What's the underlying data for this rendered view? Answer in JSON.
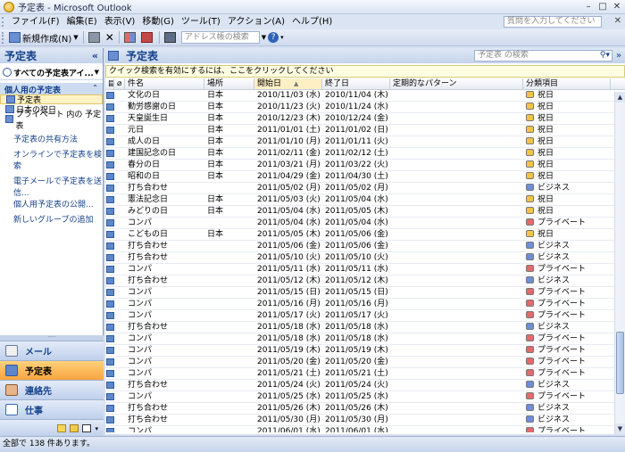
{
  "window": {
    "title": "予定表 - Microsoft Outlook"
  },
  "menu": {
    "items": [
      "ファイル(F)",
      "編集(E)",
      "表示(V)",
      "移動(G)",
      "ツール(T)",
      "アクション(A)",
      "ヘルプ(H)"
    ],
    "help_placeholder": "質問を入力してください"
  },
  "toolbar": {
    "new_label": "新規作成(N)",
    "address_search_placeholder": "アドレス帳の検索"
  },
  "nav": {
    "title": "予定表",
    "all_calendars": "すべての予定表アイ...",
    "group_title": "個人用の予定表",
    "calendars": [
      "予定表",
      "日本の祝日",
      "プライベート 内の 予定表"
    ],
    "links": [
      "予定表の共有方法",
      "オンラインで予定表を検索",
      "電子メールで予定表を送信...",
      "個人用予定表の公開...",
      "新しいグループの追加"
    ],
    "buttons": [
      "メール",
      "予定表",
      "連絡先",
      "仕事"
    ]
  },
  "main": {
    "title": "予定表",
    "search_placeholder": "予定表 の検索",
    "infobar": "クイック検索を有効にするには、ここをクリックしてください",
    "columns": [
      "件名",
      "場所",
      "開始日",
      "終了日",
      "定期的なパターン",
      "分類項目"
    ]
  },
  "colors": {
    "holiday": "#f3c24a",
    "business": "#6e8fd6",
    "private": "#e06b6b"
  },
  "rows": [
    {
      "subject": "文化の日",
      "location": "日本",
      "start": "2010/11/03 (水) 0...",
      "end": "2010/11/04 (木) 0...",
      "category": "祝日",
      "cat": "holiday"
    },
    {
      "subject": "勤労感謝の日",
      "location": "日本",
      "start": "2010/11/23 (火) 0...",
      "end": "2010/11/24 (水) 0...",
      "category": "祝日",
      "cat": "holiday"
    },
    {
      "subject": "天皇誕生日",
      "location": "日本",
      "start": "2010/12/23 (木) 0...",
      "end": "2010/12/24 (金) 0...",
      "category": "祝日",
      "cat": "holiday"
    },
    {
      "subject": "元日",
      "location": "日本",
      "start": "2011/01/01 (土) 0...",
      "end": "2011/01/02 (日) 0...",
      "category": "祝日",
      "cat": "holiday"
    },
    {
      "subject": "成人の日",
      "location": "日本",
      "start": "2011/01/10 (月) 0...",
      "end": "2011/01/11 (火) 0...",
      "category": "祝日",
      "cat": "holiday"
    },
    {
      "subject": "建国記念の日",
      "location": "日本",
      "start": "2011/02/11 (金) 0...",
      "end": "2011/02/12 (土) 0...",
      "category": "祝日",
      "cat": "holiday"
    },
    {
      "subject": "春分の日",
      "location": "日本",
      "start": "2011/03/21 (月) 0...",
      "end": "2011/03/22 (火) 0...",
      "category": "祝日",
      "cat": "holiday"
    },
    {
      "subject": "昭和の日",
      "location": "日本",
      "start": "2011/04/29 (金) 0...",
      "end": "2011/04/30 (土) 0...",
      "category": "祝日",
      "cat": "holiday"
    },
    {
      "subject": "打ち合わせ",
      "location": "",
      "start": "2011/05/02 (月) 9...",
      "end": "2011/05/02 (月) 9...",
      "category": "ビジネス",
      "cat": "business"
    },
    {
      "subject": "憲法記念日",
      "location": "日本",
      "start": "2011/05/03 (火) 0...",
      "end": "2011/05/04 (水) 0...",
      "category": "祝日",
      "cat": "holiday"
    },
    {
      "subject": "みどりの日",
      "location": "日本",
      "start": "2011/05/04 (水) 0...",
      "end": "2011/05/05 (木) 0...",
      "category": "祝日",
      "cat": "holiday"
    },
    {
      "subject": "コンパ",
      "location": "",
      "start": "2011/05/04 (水) 1...",
      "end": "2011/05/04 (水) 1...",
      "category": "プライベート",
      "cat": "private"
    },
    {
      "subject": "こどもの日",
      "location": "日本",
      "start": "2011/05/05 (木) 0...",
      "end": "2011/05/06 (金) 0...",
      "category": "祝日",
      "cat": "holiday"
    },
    {
      "subject": "打ち合わせ",
      "location": "",
      "start": "2011/05/06 (金) 9...",
      "end": "2011/05/06 (金) 9...",
      "category": "ビジネス",
      "cat": "business"
    },
    {
      "subject": "打ち合わせ",
      "location": "",
      "start": "2011/05/10 (火) 9...",
      "end": "2011/05/10 (火) 9...",
      "category": "ビジネス",
      "cat": "business"
    },
    {
      "subject": "コンパ",
      "location": "",
      "start": "2011/05/11 (水) 1...",
      "end": "2011/05/11 (水) 1...",
      "category": "プライベート",
      "cat": "private"
    },
    {
      "subject": "打ち合わせ",
      "location": "",
      "start": "2011/05/12 (木) 9...",
      "end": "2011/05/12 (木) 9...",
      "category": "ビジネス",
      "cat": "business"
    },
    {
      "subject": "コンパ",
      "location": "",
      "start": "2011/05/15 (日) 1...",
      "end": "2011/05/15 (日) 1...",
      "category": "プライベート",
      "cat": "private"
    },
    {
      "subject": "コンパ",
      "location": "",
      "start": "2011/05/16 (月) 1...",
      "end": "2011/05/16 (月) 1...",
      "category": "プライベート",
      "cat": "private"
    },
    {
      "subject": "コンパ",
      "location": "",
      "start": "2011/05/17 (火) 1...",
      "end": "2011/05/17 (火) 1...",
      "category": "プライベート",
      "cat": "private"
    },
    {
      "subject": "打ち合わせ",
      "location": "",
      "start": "2011/05/18 (水) 9...",
      "end": "2011/05/18 (水) 9...",
      "category": "ビジネス",
      "cat": "business"
    },
    {
      "subject": "コンパ",
      "location": "",
      "start": "2011/05/18 (水) 1...",
      "end": "2011/05/18 (水) 1...",
      "category": "プライベート",
      "cat": "private"
    },
    {
      "subject": "コンパ",
      "location": "",
      "start": "2011/05/19 (木) 1...",
      "end": "2011/05/19 (木) 1...",
      "category": "プライベート",
      "cat": "private"
    },
    {
      "subject": "コンパ",
      "location": "",
      "start": "2011/05/20 (金) 1...",
      "end": "2011/05/20 (金) 1...",
      "category": "プライベート",
      "cat": "private"
    },
    {
      "subject": "コンパ",
      "location": "",
      "start": "2011/05/21 (土) 1...",
      "end": "2011/05/21 (土) 1...",
      "category": "プライベート",
      "cat": "private"
    },
    {
      "subject": "打ち合わせ",
      "location": "",
      "start": "2011/05/24 (火) 9...",
      "end": "2011/05/24 (火) 9...",
      "category": "ビジネス",
      "cat": "business"
    },
    {
      "subject": "コンパ",
      "location": "",
      "start": "2011/05/25 (水) 1...",
      "end": "2011/05/25 (水) 1...",
      "category": "プライベート",
      "cat": "private"
    },
    {
      "subject": "打ち合わせ",
      "location": "",
      "start": "2011/05/26 (木) 9...",
      "end": "2011/05/26 (木) 9...",
      "category": "ビジネス",
      "cat": "business"
    },
    {
      "subject": "打ち合わせ",
      "location": "",
      "start": "2011/05/30 (月) 9...",
      "end": "2011/05/30 (月) 9...",
      "category": "ビジネス",
      "cat": "business"
    },
    {
      "subject": "コンパ",
      "location": "",
      "start": "2011/06/01 (水) 1...",
      "end": "2011/06/01 (水) 1...",
      "category": "プライベート",
      "cat": "private"
    }
  ],
  "status": {
    "text": "全部で 138 件あります。"
  }
}
